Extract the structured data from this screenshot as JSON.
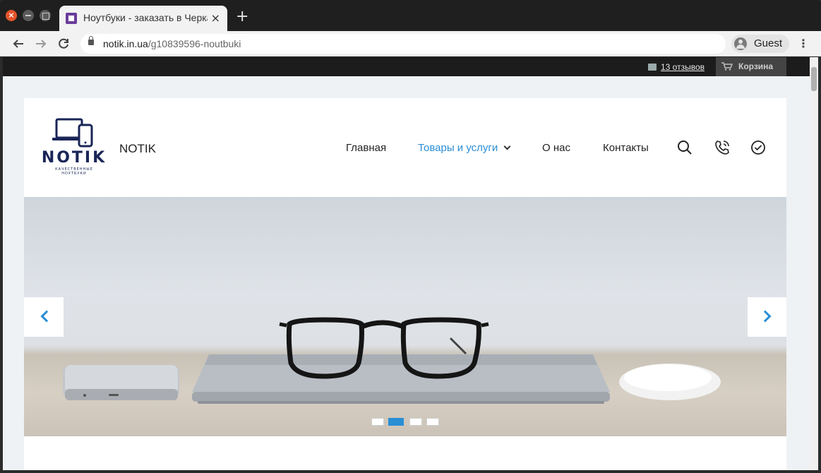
{
  "browser": {
    "tab_title": "Ноутбуки - заказать в Черкассах",
    "tab_close": "×",
    "new_tab": "+",
    "url_domain": "notik.in.ua",
    "url_path": "/g10839596-noutbuki",
    "profile_name": "Guest",
    "menu": "⋮",
    "close_glyph": "×"
  },
  "topbar": {
    "reviews": "13 отзывов",
    "cart": "Корзина"
  },
  "header": {
    "logo_brand": "NOTIK",
    "logo_tagline": "КАЧЕСТВЕННЫЕ НОУТБУКИ",
    "site_name": "NOTIK",
    "nav": [
      {
        "label": "Главная"
      },
      {
        "label": "Товары и услуги"
      },
      {
        "label": "О нас"
      },
      {
        "label": "Контакты"
      }
    ]
  },
  "slider": {
    "slide_count": 4,
    "active_slide": 2
  },
  "colors": {
    "accent": "#2a8ed4",
    "brand": "#1a2557",
    "topbar": "#1c1c1c"
  }
}
